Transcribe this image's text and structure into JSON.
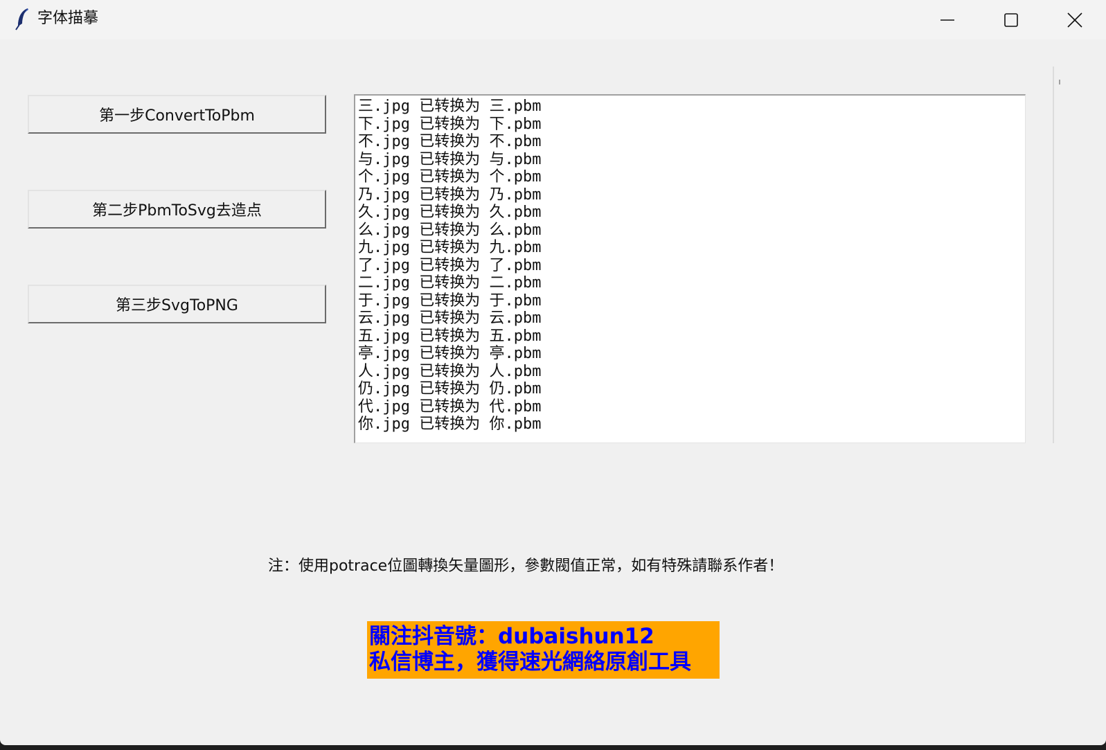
{
  "window": {
    "title": "字体描摹",
    "controls": {
      "minimize": "minimize-icon",
      "maximize": "maximize-icon",
      "close": "close-icon"
    }
  },
  "buttons": {
    "step1": "第一步ConvertToPbm",
    "step2": "第二步PbmToSvg去造点",
    "step3": "第三步SvgToPNG"
  },
  "log": [
    "三.jpg 已转换为 三.pbm",
    "下.jpg 已转换为 下.pbm",
    "不.jpg 已转换为 不.pbm",
    "与.jpg 已转换为 与.pbm",
    "个.jpg 已转换为 个.pbm",
    "乃.jpg 已转换为 乃.pbm",
    "久.jpg 已转换为 久.pbm",
    "么.jpg 已转换为 么.pbm",
    "九.jpg 已转换为 九.pbm",
    "了.jpg 已转换为 了.pbm",
    "二.jpg 已转换为 二.pbm",
    "于.jpg 已转换为 于.pbm",
    "云.jpg 已转换为 云.pbm",
    "五.jpg 已转换为 五.pbm",
    "亭.jpg 已转换为 亭.pbm",
    "人.jpg 已转换为 人.pbm",
    "仍.jpg 已转换为 仍.pbm",
    "代.jpg 已转换为 代.pbm",
    "你.jpg 已转换为 你.pbm"
  ],
  "note": "注：使用potrace位圖轉換矢量圖形，參數閥值正常，如有特殊請聯系作者！",
  "promo": {
    "line1": "關注抖音號：dubaishun12",
    "line2": "私信博主，獲得速光網絡原創工具"
  },
  "colors": {
    "promo_bg": "#ffa500",
    "promo_text": "#0000ff",
    "window_bg": "#f0f0f0"
  }
}
